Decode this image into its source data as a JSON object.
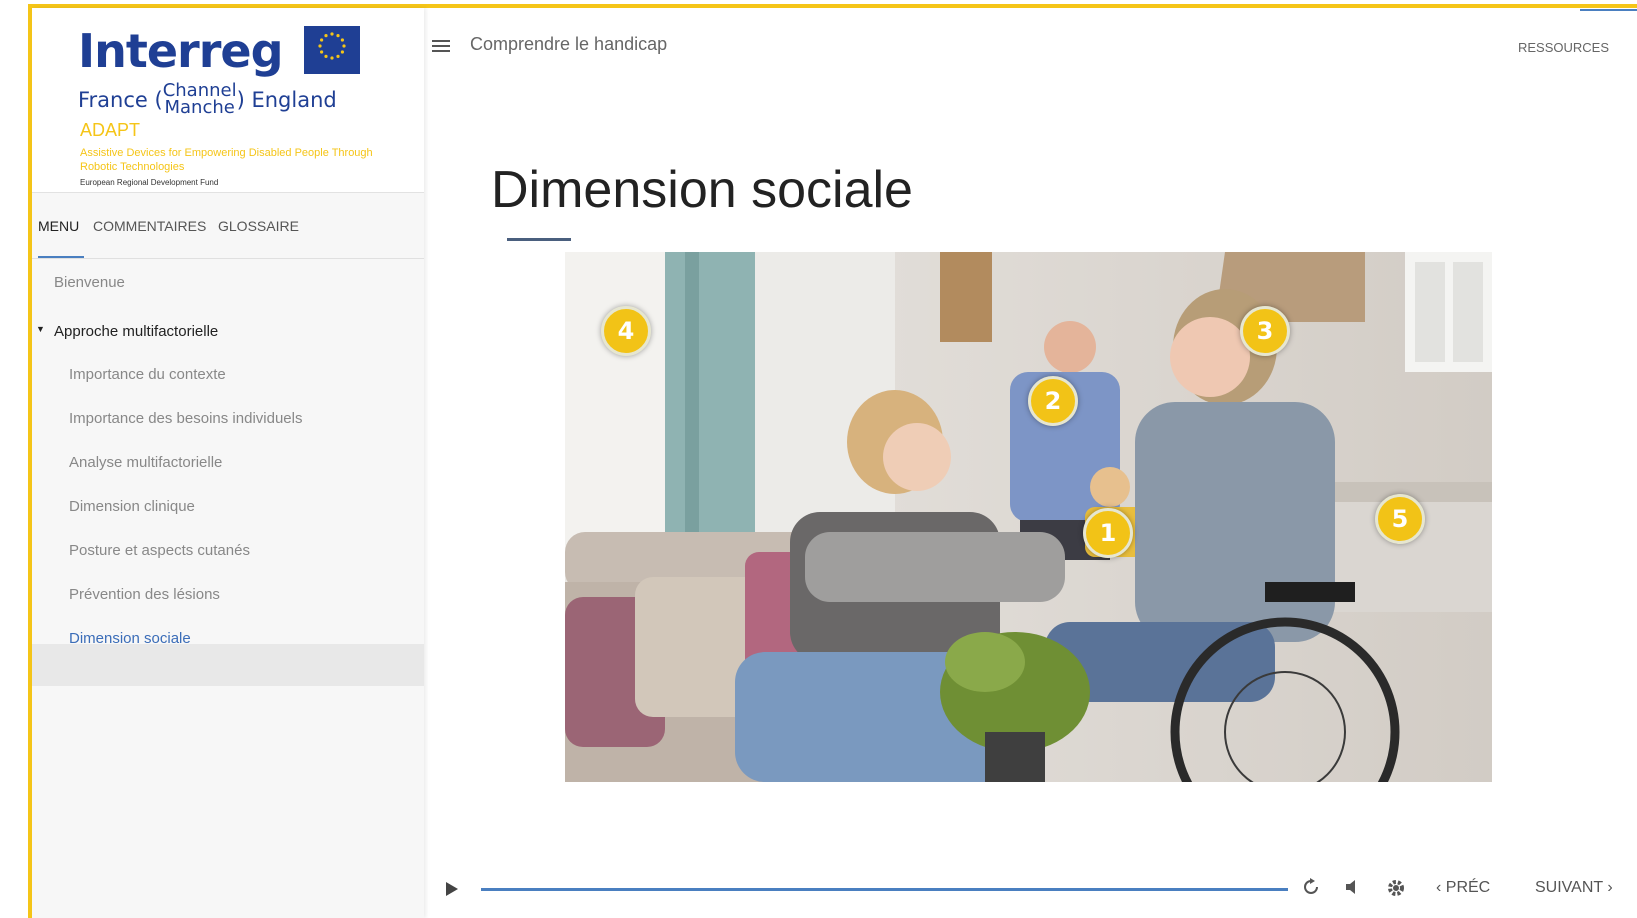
{
  "logo": {
    "wordmark": "Interreg",
    "eu_caption": "EUROPEAN UNION",
    "country_left": "France (",
    "channel_top": "Channel",
    "channel_bottom": "Manche",
    "country_right": ") England",
    "project": "ADAPT",
    "tagline": "Assistive Devices for Empowering Disabled People Through Robotic Technologies",
    "fund": "European Regional Development Fund"
  },
  "sidebar": {
    "tabs": [
      {
        "label": "MENU"
      },
      {
        "label": "COMMENTAIRES"
      },
      {
        "label": "GLOSSAIRE"
      }
    ],
    "items": [
      {
        "label": "Bienvenue"
      },
      {
        "label": "Approche multifactorielle"
      },
      {
        "label": "Importance du contexte"
      },
      {
        "label": "Importance des besoins individuels"
      },
      {
        "label": "Analyse multifactorielle"
      },
      {
        "label": "Dimension clinique"
      },
      {
        "label": "Posture et aspects cutanés"
      },
      {
        "label": "Prévention des lésions"
      },
      {
        "label": "Dimension sociale"
      }
    ]
  },
  "header": {
    "course_title": "Comprendre le handicap",
    "resources_label": "RESSOURCES"
  },
  "main": {
    "page_title": "Dimension sociale",
    "hotspots": [
      {
        "label": "1"
      },
      {
        "label": "2"
      },
      {
        "label": "3"
      },
      {
        "label": "4"
      },
      {
        "label": "5"
      }
    ]
  },
  "player": {
    "progress_percent": 100,
    "prev_label": "PRÉC",
    "next_label": "SUIVANT"
  },
  "colors": {
    "accent": "#4a7fc0",
    "frame": "#f5c518",
    "hotspot": "#f2c317",
    "brand": "#1f3f94"
  }
}
